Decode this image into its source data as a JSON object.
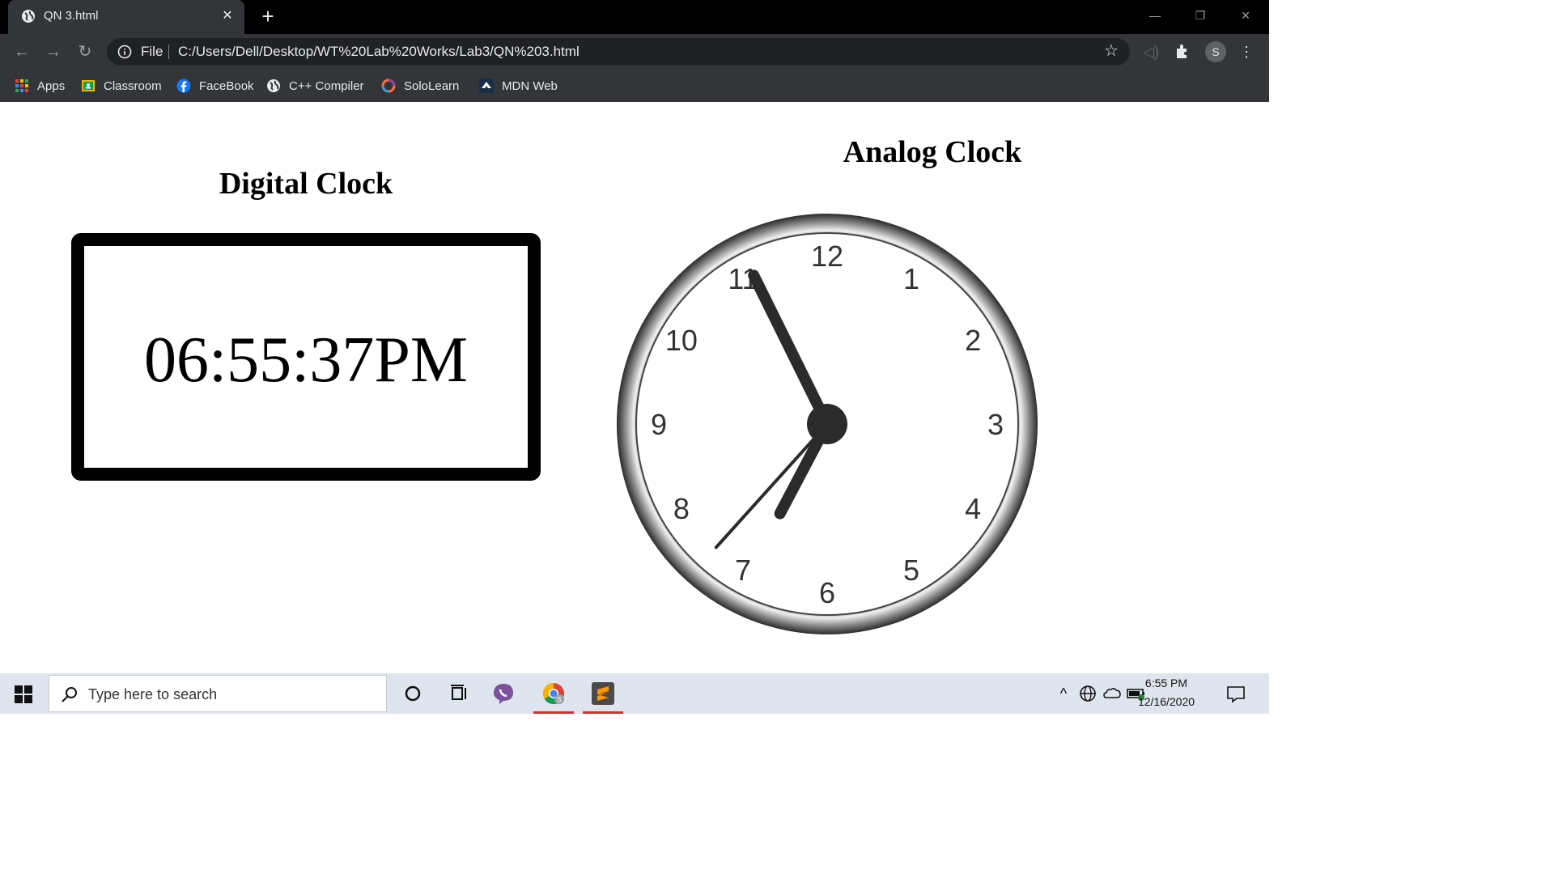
{
  "browser": {
    "tab_title": "QN 3.html",
    "tab_close": "✕",
    "new_tab": "+",
    "omnibox_scheme_label": "File",
    "url": "C:/Users/Dell/Desktop/WT%20Lab%20Works/Lab3/QN%203.html",
    "profile_initial": "S",
    "bookmarks": [
      {
        "label": "Apps",
        "icon": "apps-grid-icon"
      },
      {
        "label": "Classroom",
        "icon": "classroom-icon"
      },
      {
        "label": "FaceBook",
        "icon": "facebook-icon"
      },
      {
        "label": "C++ Compiler",
        "icon": "globe-icon"
      },
      {
        "label": "SoloLearn",
        "icon": "sololearn-icon"
      },
      {
        "label": "MDN Web",
        "icon": "mdn-icon"
      }
    ]
  },
  "page": {
    "digital_heading": "Digital Clock",
    "digital_time": "06:55:37PM",
    "analog_heading": "Analog Clock",
    "analog_numbers": [
      "12",
      "1",
      "2",
      "3",
      "4",
      "5",
      "6",
      "7",
      "8",
      "9",
      "10",
      "11"
    ],
    "analog_time": {
      "hours": 6,
      "minutes": 55,
      "seconds": 37
    }
  },
  "taskbar": {
    "search_placeholder": "Type here to search",
    "time": "6:55 PM",
    "date": "12/16/2020"
  },
  "colors": {
    "tabbar": "#000000",
    "toolbar": "#333538",
    "omnibox": "#202124",
    "taskbar": "#dfe5ee",
    "clock_hands": "#2b2b2b"
  }
}
